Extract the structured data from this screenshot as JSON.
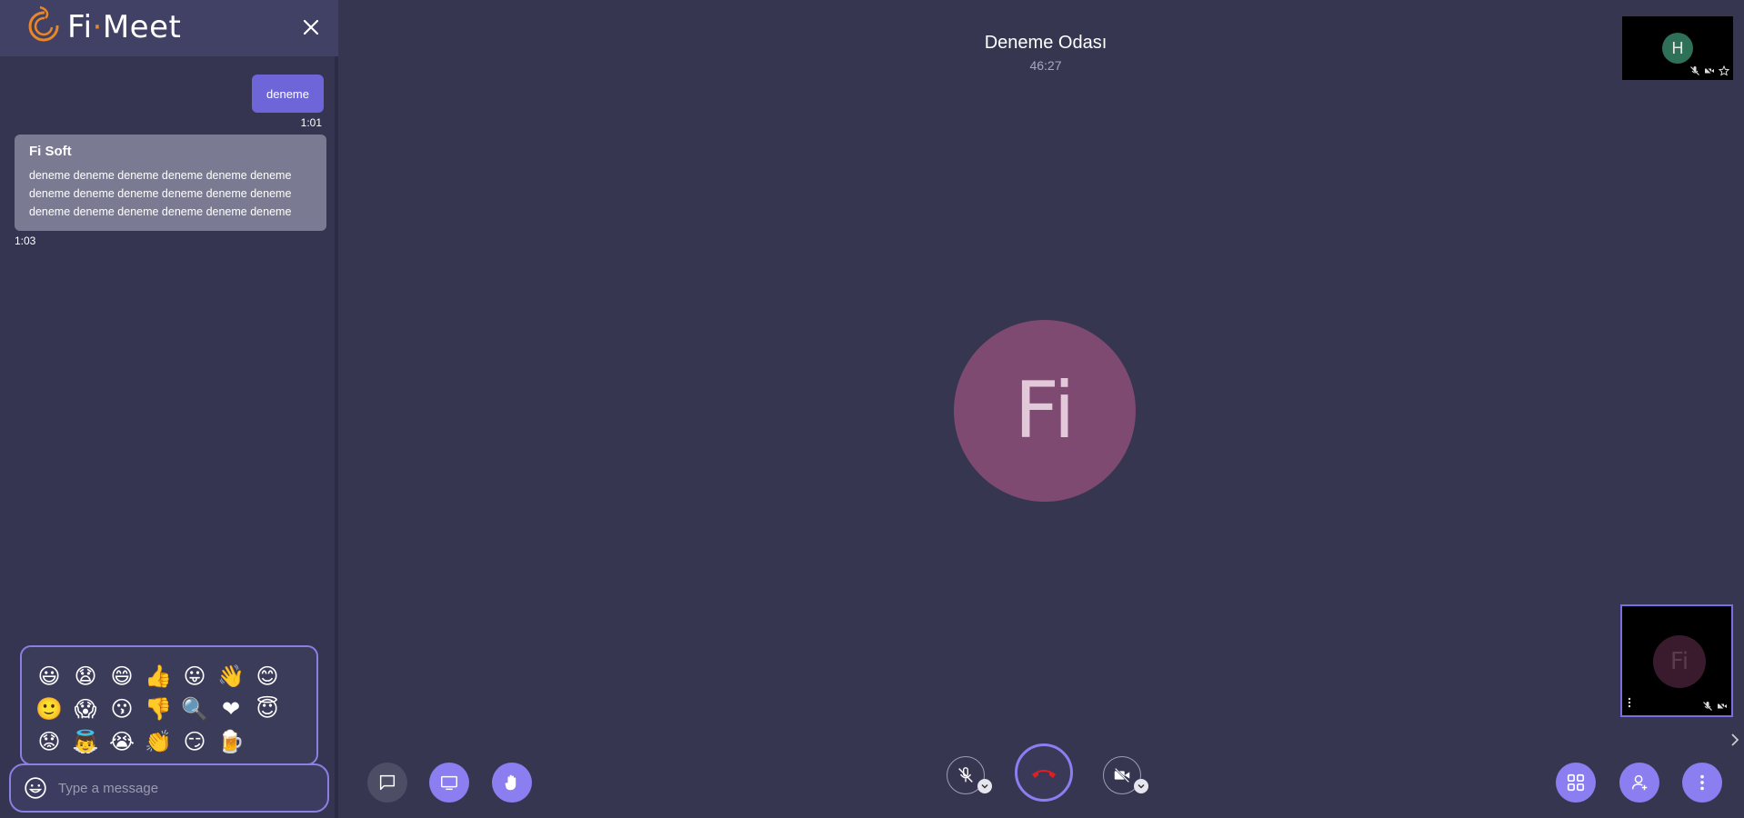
{
  "app": {
    "logo_text_left": "Fi",
    "logo_dot": "·",
    "logo_text_right": "Meet"
  },
  "chat": {
    "messages": [
      {
        "own": true,
        "text": "deneme",
        "time": "1:01"
      },
      {
        "own": false,
        "author": "Fi Soft",
        "text": "deneme deneme deneme deneme deneme deneme deneme deneme deneme deneme deneme deneme deneme deneme deneme deneme deneme deneme",
        "time": "1:03"
      }
    ],
    "emojis": [
      "😃",
      "😧",
      "😄",
      "👍",
      "😛",
      "👋",
      "😊",
      "🙂",
      "😱",
      "😗",
      "👎",
      "🔍",
      "❤",
      "😇",
      "😟",
      "👼",
      "😭",
      "👏",
      "😏",
      "🍺"
    ],
    "input_placeholder": "Type a message"
  },
  "room": {
    "name": "Deneme Odası",
    "elapsed": "46:27"
  },
  "participants": {
    "main_initials": "Fi",
    "remote_initial": "H",
    "local_initials": "Fi"
  },
  "colors": {
    "accent": "#8b7ef0",
    "background": "#363651",
    "sidebar": "#353552",
    "main_avatar": "#7e4a71",
    "remote_avatar": "#2e7058",
    "hangup": "#e01e24"
  }
}
